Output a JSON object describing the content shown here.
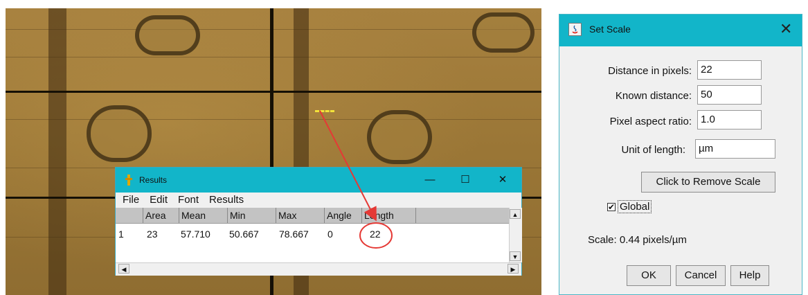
{
  "results": {
    "title": "Results",
    "menu": [
      "File",
      "Edit",
      "Font",
      "Results"
    ],
    "columns": [
      "",
      "Area",
      "Mean",
      "Min",
      "Max",
      "Angle",
      "Length"
    ],
    "row": [
      "1",
      "23",
      "57.710",
      "50.667",
      "78.667",
      "0",
      "22"
    ],
    "controls": {
      "minimize": "—",
      "maximize": "☐",
      "close": "✕"
    },
    "scroll": {
      "up": "▲",
      "down": "▼",
      "left": "◀",
      "right": "▶"
    }
  },
  "set_scale": {
    "title": "Set Scale",
    "close": "✕",
    "fields": {
      "distance_pixels": {
        "label": "Distance in pixels:",
        "value": "22"
      },
      "known_distance": {
        "label": "Known distance:",
        "value": "50"
      },
      "aspect_ratio": {
        "label": "Pixel aspect ratio:",
        "value": "1.0"
      },
      "unit": {
        "label": "Unit of length:",
        "value": "µm"
      }
    },
    "remove_scale_label": "Click to Remove Scale",
    "global_label": "Global",
    "global_checked": true,
    "check_mark": "✔",
    "scale_text": "Scale: 0.44 pixels/µm",
    "ok_label": "OK",
    "cancel_label": "Cancel",
    "help_label": "Help"
  },
  "colors": {
    "titlebar": "#12b5c9",
    "annotation": "#e53935",
    "selection_line": "#f2e23a"
  }
}
